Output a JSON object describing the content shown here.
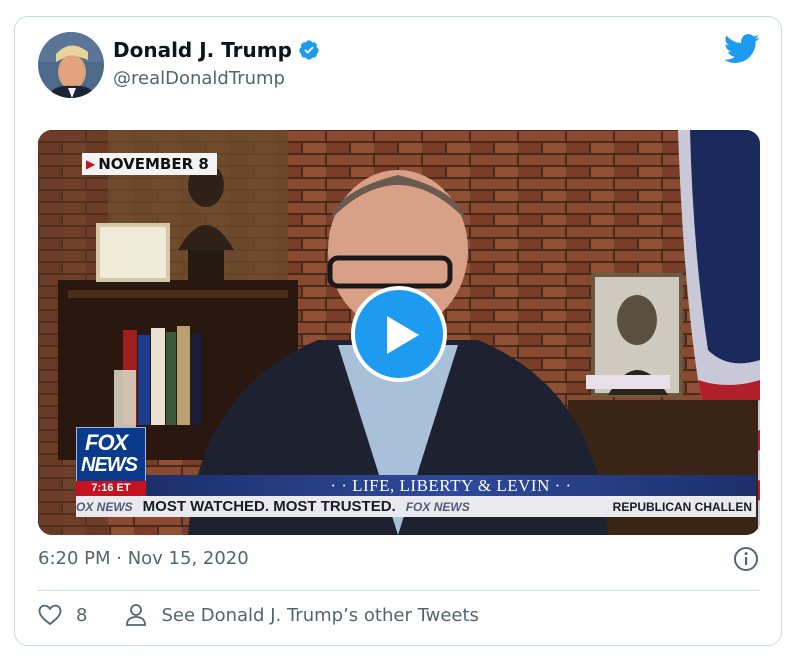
{
  "tweet": {
    "author_name": "Donald J. Trump",
    "handle": "@realDonaldTrump",
    "timestamp": "6:20 PM · Nov 15, 2020",
    "like_count": "8",
    "other_tweets_link": "See Donald J. Trump’s other Tweets"
  },
  "video": {
    "date_chip": "NOVEMBER 8",
    "network_line1": "FOX",
    "network_line2": "NEWS",
    "network_time": "7:16 ET",
    "show_title": "· · LIFE, LIBERTY & LEVIN · ·",
    "ticker_left": "OX NEWS",
    "ticker_main": "MOST WATCHED. MOST TRUSTED.",
    "ticker_mid": "FOX NEWS",
    "ticker_right": "REPUBLICAN CHALLEN"
  },
  "colors": {
    "accent": "#1d9bf0",
    "text_primary": "#0f1419",
    "text_secondary": "#536471",
    "border": "#cfd9de"
  },
  "icons": {
    "twitter": "twitter-bird-icon",
    "verified": "verified-badge-icon",
    "play": "play-icon",
    "info": "info-icon",
    "like": "heart-icon",
    "profile": "person-icon"
  }
}
